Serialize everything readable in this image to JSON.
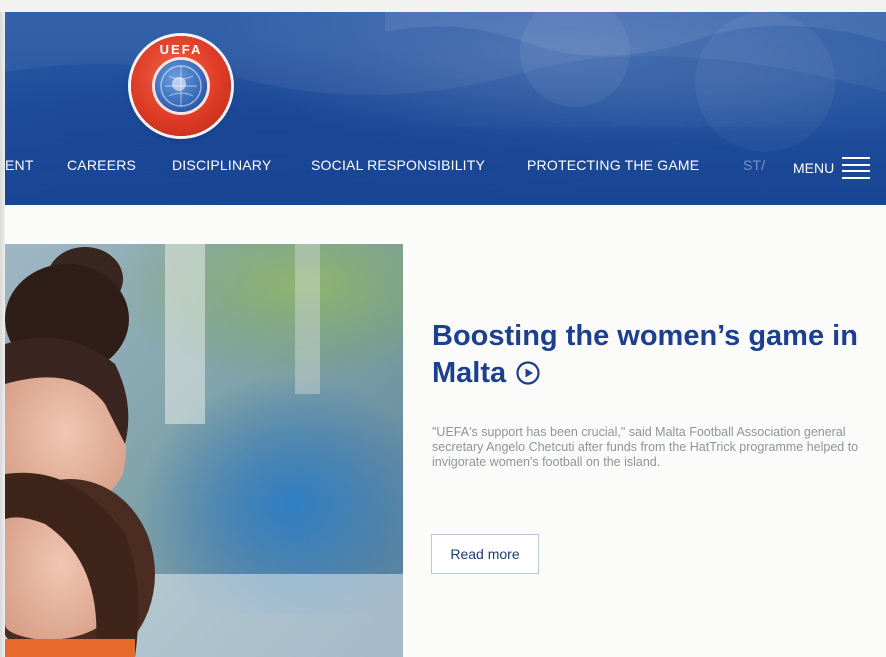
{
  "brand": {
    "logo_text": "UEFA",
    "primary_color": "#1f4f9d",
    "accent_color": "#de3b25",
    "title_color": "#1d3f8f"
  },
  "nav": {
    "items": [
      {
        "label": "ENT",
        "faded": false
      },
      {
        "label": "CAREERS",
        "faded": false
      },
      {
        "label": "DISCIPLINARY",
        "faded": false
      },
      {
        "label": "SOCIAL RESPONSIBILITY",
        "faded": false
      },
      {
        "label": "PROTECTING THE GAME",
        "faded": false
      },
      {
        "label": "ST/",
        "faded": true
      }
    ],
    "menu_label": "MENU",
    "menu_icon": "hamburger-menu-icon"
  },
  "article": {
    "title_line1": "Boosting the women’s game in",
    "title_line2": "Malta",
    "title_icon": "play-circle-icon",
    "body": "\"UEFA's support has been crucial,\" said Malta Football Association general secretary Angelo Chetcuti after funds from the HatTrick programme helped to invigorate women's football on the island.",
    "read_more_label": "Read more"
  }
}
